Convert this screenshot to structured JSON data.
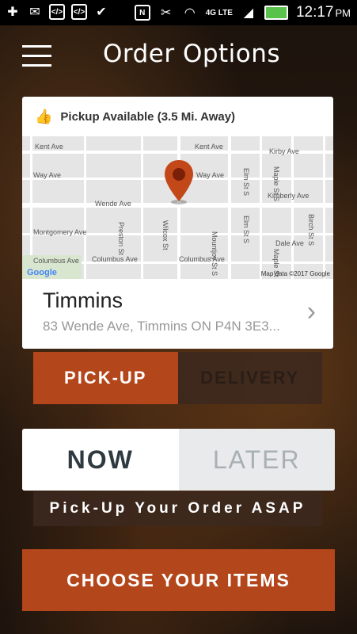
{
  "status_bar": {
    "time": "12:17",
    "ampm": "PM",
    "network": "4G LTE"
  },
  "header": {
    "title": "Order Options"
  },
  "location_card": {
    "pickup_text": "Pickup Available (3.5 Mi. Away)",
    "map": {
      "streets": [
        "Kent Ave",
        "Kent Ave",
        "Kirby Ave",
        "Way Ave",
        "Way Ave",
        "Kimberly Ave",
        "Wende Ave",
        "Montgomery Ave",
        "Columbus Ave",
        "Columbus Ave",
        "Columbus Ave",
        "Dale Ave",
        "Cameron St S",
        "Preston St",
        "Wilcox St",
        "Mountjoy St S",
        "Elm St S",
        "Elm St S",
        "Maple St S",
        "Maple St",
        "Birch St S"
      ],
      "google_label": "Google",
      "attribution": "Map data ©2017 Google"
    },
    "city": "Timmins",
    "address": "83 Wende Ave, Timmins ON P4N 3E3..."
  },
  "fulfillment_tabs": {
    "pickup": "PICK-UP",
    "delivery": "DELIVERY"
  },
  "time_tabs": {
    "now": "NOW",
    "later": "LATER"
  },
  "asap_message": "Pick-Up Your Order ASAP",
  "cta_label": "CHOOSE YOUR ITEMS",
  "colors": {
    "accent": "#b4461b",
    "pin": "#c2481a"
  }
}
